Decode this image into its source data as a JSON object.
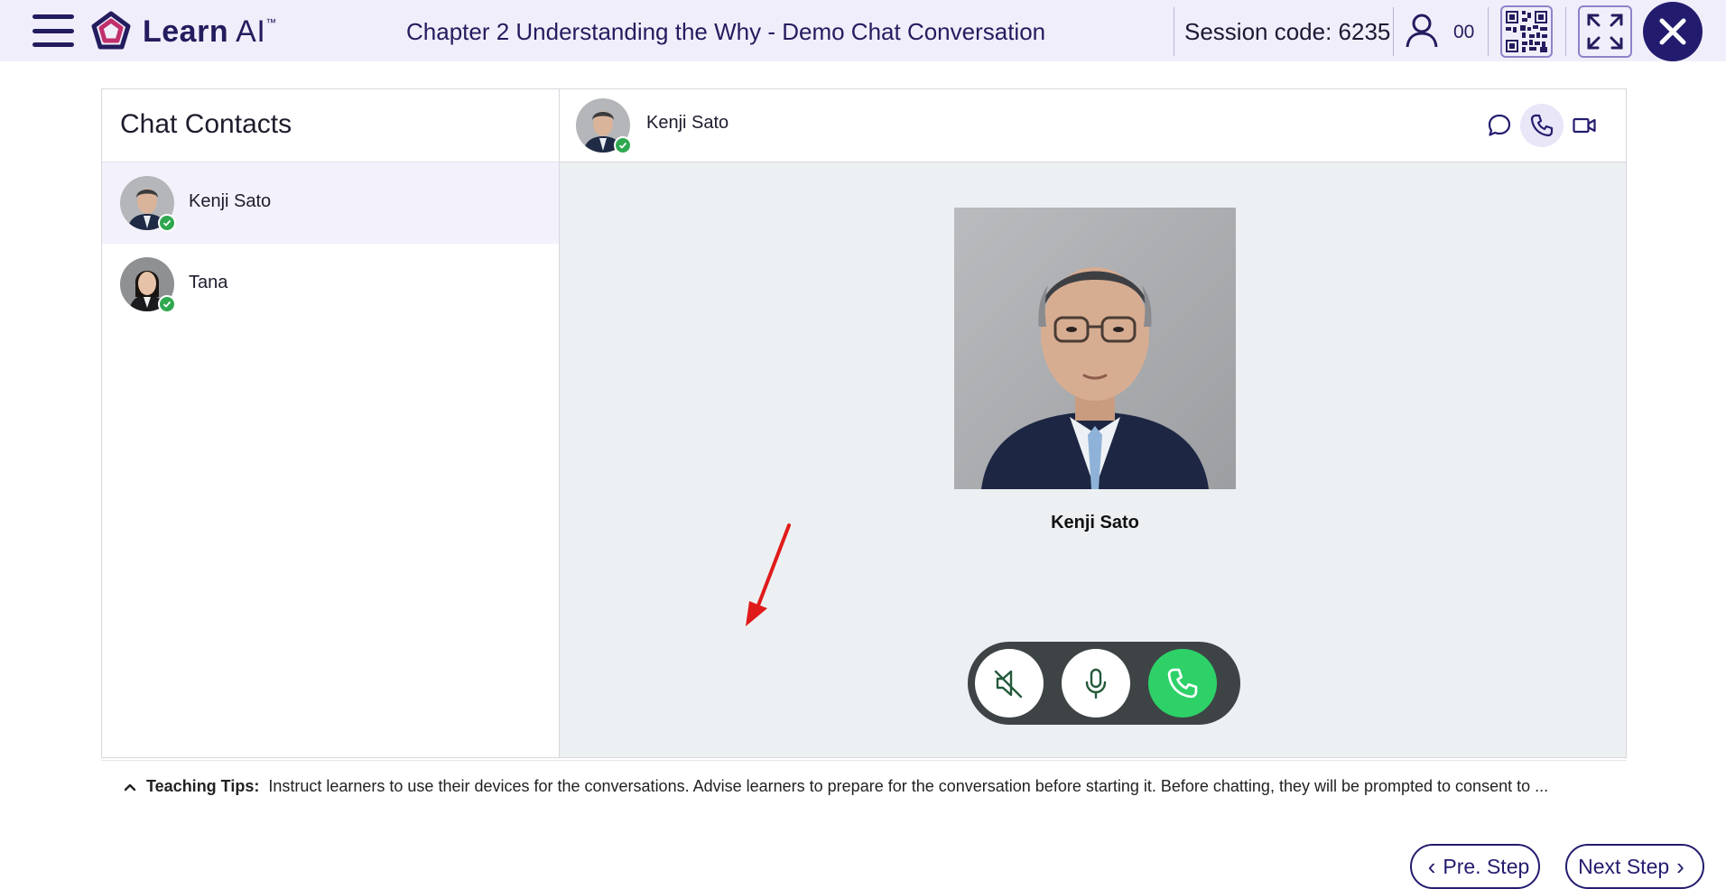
{
  "app": {
    "logo_word": "Learn",
    "logo_suffix": "AI",
    "logo_tm": "™",
    "chapter_title": "Chapter 2 Understanding the Why - Demo Chat Conversation",
    "session_label": "Session code: 6235",
    "participant_count": "00"
  },
  "contacts": {
    "title": "Chat Contacts",
    "items": [
      {
        "name": "Kenji Sato",
        "status": "online",
        "active": true
      },
      {
        "name": "Tana",
        "status": "online",
        "active": false
      }
    ]
  },
  "chat": {
    "contact_name": "Kenji Sato",
    "header_icons": [
      "chat-bubble-icon",
      "phone-icon",
      "video-icon"
    ],
    "active_mode": "phone",
    "call": {
      "caller_name": "Kenji Sato",
      "controls": [
        "speaker-muted-icon",
        "microphone-icon",
        "phone-call-icon"
      ]
    }
  },
  "tips": {
    "label": "Teaching Tips:",
    "text": "Instruct learners to use their devices for the conversations. Advise learners to prepare for the conversation before starting it. Before chatting, they will be prompted to consent to ..."
  },
  "nav": {
    "prev_label": "Pre. Step",
    "next_label": "Next Step"
  },
  "colors": {
    "brand": "#231c6e",
    "header_bg": "#f1eefb",
    "call_green": "#2dd168",
    "online_green": "#2fa84f",
    "annotation_red": "#e01b1b"
  }
}
